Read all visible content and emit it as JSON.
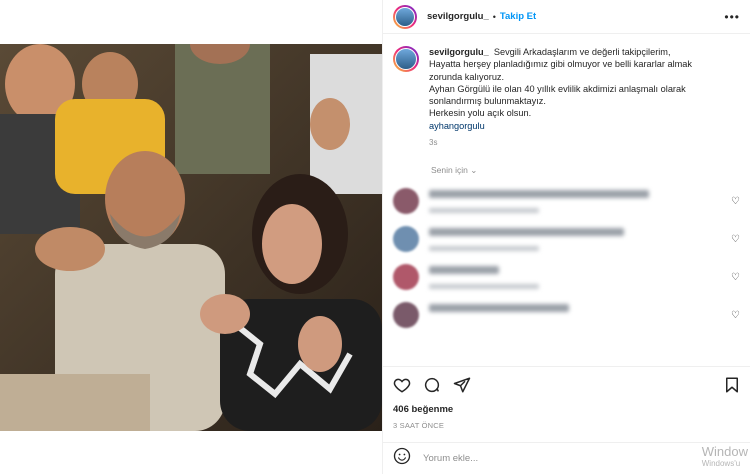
{
  "post": {
    "username": "sevilgorgulu_",
    "follow_label": "Takip Et",
    "caption_lines": [
      "Sevgili Arkadaşlarım ve değerli takipçilerim,",
      "Hayatta herşey planladığımız gibi olmuyor ve belli kararlar almak",
      "zorunda kalıyoruz.",
      "Ayhan Görgülü ile olan 40 yıllık evlilik akdimizi anlaşmalı olarak",
      "sonlandırmış bulunmaktayız.",
      "Herkesin yolu açık olsun.",
      "ayhangorgulu"
    ],
    "caption_time": "3s",
    "for_you_label": "Senin için",
    "likes": "406 beğenme",
    "posted_ago": "3 SAAT ÖNCE",
    "comment_placeholder": "Yorum ekle..."
  },
  "icons": {
    "more": "more-icon",
    "like": "heart-icon",
    "comment": "comment-icon",
    "share": "share-icon",
    "save": "bookmark-icon",
    "emoji": "emoji-icon"
  },
  "colors": {
    "accent": "#0095f6",
    "text": "#262626",
    "muted": "#8e8e8e"
  },
  "watermark": {
    "line1": "Window",
    "line2": "Windows'u"
  }
}
